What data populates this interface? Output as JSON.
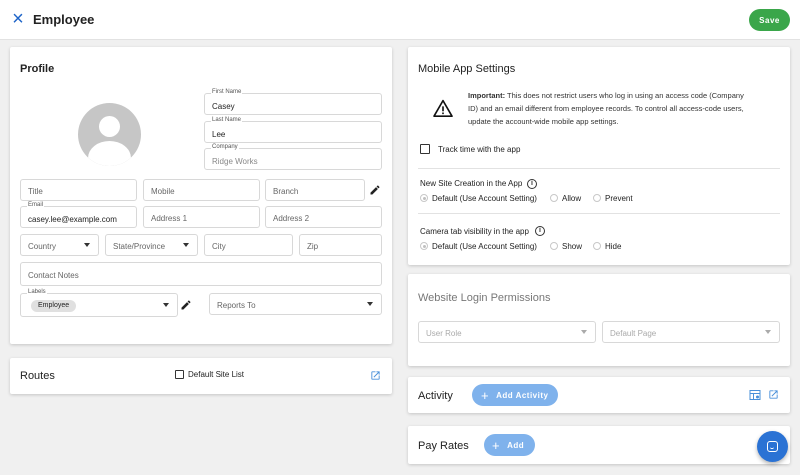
{
  "header": {
    "close_icon": "×",
    "title": "Employee",
    "save_label": "Save"
  },
  "colors": {
    "accent_blue": "#1e64c8",
    "save_green": "#3aa64a",
    "pill_blue": "#7fb2ec"
  },
  "profile": {
    "title": "Profile",
    "first_name": {
      "label": "First Name",
      "value": "Casey"
    },
    "last_name": {
      "label": "Last Name",
      "value": "Lee"
    },
    "company": {
      "label": "Company",
      "placeholder": "Ridge Works"
    },
    "title_field": {
      "placeholder": "Title"
    },
    "mobile": {
      "placeholder": "Mobile"
    },
    "branch": {
      "placeholder": "Branch"
    },
    "email": {
      "label": "Email",
      "value": "casey.lee@example.com"
    },
    "address1": {
      "placeholder": "Address 1"
    },
    "address2": {
      "placeholder": "Address 2"
    },
    "country": {
      "placeholder": "Country"
    },
    "state": {
      "placeholder": "State/Province"
    },
    "city": {
      "placeholder": "City"
    },
    "zip": {
      "placeholder": "Zip"
    },
    "contact_notes": {
      "placeholder": "Contact Notes"
    },
    "labels": {
      "label": "Labels",
      "chip": "Employee"
    },
    "reports_to": {
      "placeholder": "Reports To"
    }
  },
  "routes": {
    "title": "Routes",
    "default_site_list": "Default Site List"
  },
  "mobile_app": {
    "title": "Mobile App Settings",
    "warning_bold": "Important:",
    "warning_line1": " This does not restrict users who log in using an access code (Company",
    "warning_line2": "ID) and an email different from employee records. To control all access-code users,",
    "warning_line3": "update the account-wide mobile app settings.",
    "track_time": "Track time with the app",
    "site_creation": {
      "label": "New Site Creation in the App",
      "options": [
        "Default (Use Account Setting)",
        "Allow",
        "Prevent"
      ],
      "selected": "Default (Use Account Setting)"
    },
    "camera_tab": {
      "label": "Camera tab visibility in the app",
      "options": [
        "Default (Use Account Setting)",
        "Show",
        "Hide"
      ],
      "selected": "Default (Use Account Setting)"
    }
  },
  "website_login": {
    "title": "Website Login Permissions",
    "user_role": {
      "placeholder": "User Role"
    },
    "default_page": {
      "placeholder": "Default Page"
    }
  },
  "activity": {
    "title": "Activity",
    "add_label": "Add Activity"
  },
  "pay_rates": {
    "title": "Pay Rates",
    "add_label": "Add"
  }
}
